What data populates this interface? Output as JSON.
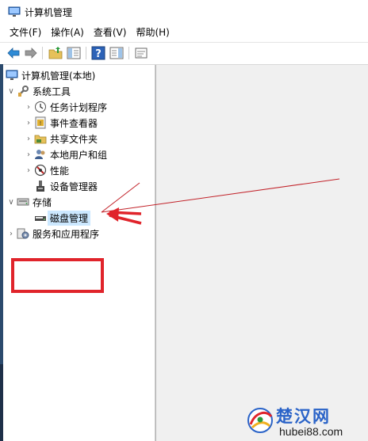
{
  "window": {
    "title": "计算机管理"
  },
  "menu": [
    "文件(F)",
    "操作(A)",
    "查看(V)",
    "帮助(H)"
  ],
  "toolbar": [
    "back-icon",
    "forward-icon",
    "up-folder-icon",
    "show-hide-tree-icon",
    "help-icon",
    "show-hide-action-pane-icon",
    "properties-icon"
  ],
  "tree": {
    "root": "计算机管理(本地)",
    "system_tools": "系统工具",
    "task_scheduler": "任务计划程序",
    "event_viewer": "事件查看器",
    "shared_folders": "共享文件夹",
    "local_users": "本地用户和组",
    "performance": "性能",
    "device_manager": "设备管理器",
    "storage": "存储",
    "disk_management": "磁盘管理",
    "services_apps": "服务和应用程序"
  },
  "watermark": {
    "name": "楚汉网",
    "url": "hubei88.com"
  },
  "colors": {
    "selection": "#cce8ff",
    "annotation": "#e0242b",
    "pane_bg": "#f0f0f0"
  }
}
